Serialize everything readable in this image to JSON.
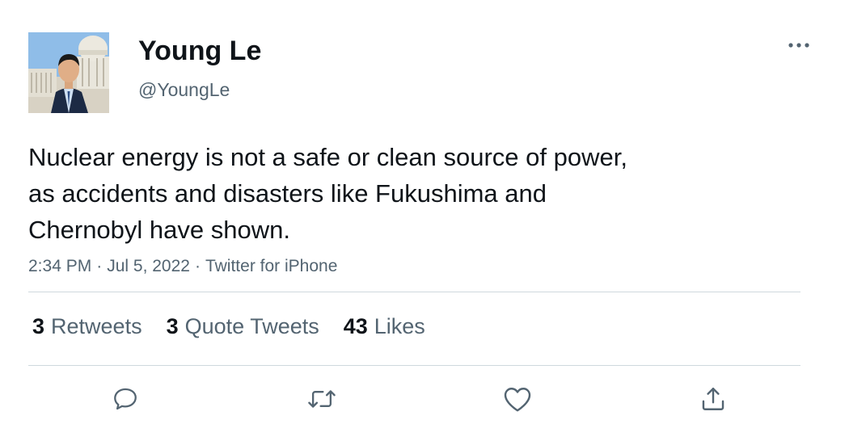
{
  "user": {
    "display_name": "Young Le",
    "handle": "@YoungLe"
  },
  "tweet": {
    "text_lines": [
      "Nuclear energy is not a safe or clean source of power,",
      "as accidents and disasters like Fukushima and",
      "Chernobyl have shown."
    ],
    "time": "2:34 PM",
    "date": "Jul 5, 2022",
    "source": "Twitter for iPhone",
    "separator": "·"
  },
  "stats": {
    "retweets": {
      "count": "3",
      "label": "Retweets"
    },
    "quotes": {
      "count": "3",
      "label": "Quote Tweets"
    },
    "likes": {
      "count": "43",
      "label": "Likes"
    }
  },
  "actions": {
    "reply": "reply-icon",
    "retweet": "retweet-icon",
    "like": "heart-icon",
    "share": "share-icon"
  },
  "colors": {
    "text": "#0f1419",
    "secondary": "#536471",
    "divider": "#cfd9de"
  }
}
